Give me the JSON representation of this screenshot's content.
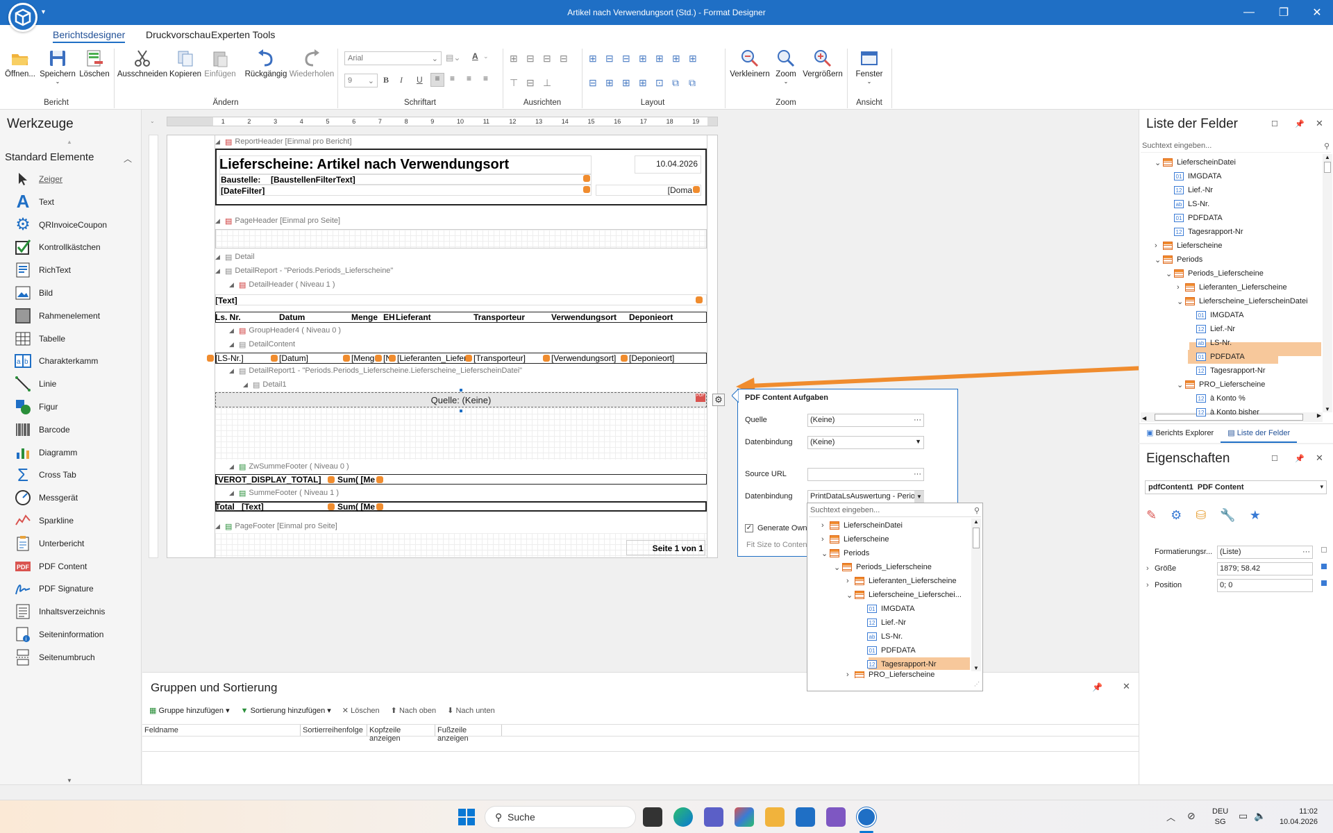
{
  "window": {
    "title": "Artikel nach Verwendungsort (Std.) - Format Designer"
  },
  "ribbon": {
    "tabs": [
      "Berichtsdesigner",
      "Druckvorschau",
      "Experten Tools"
    ],
    "buttons": {
      "open": "Öffnen...",
      "save": "Speichern",
      "delete": "Löschen",
      "cut": "Ausschneiden",
      "copy": "Kopieren",
      "paste": "Einfügen",
      "undo": "Rückgängig",
      "redo": "Wiederholen",
      "zoom_out": "Verkleinern",
      "zoom": "Zoom",
      "zoom_in": "Vergrößern",
      "window": "Fenster"
    },
    "font_name": "Arial",
    "font_size": "9",
    "groups": [
      "Bericht",
      "Ändern",
      "Schriftart",
      "Ausrichten",
      "Layout",
      "Zoom",
      "Ansicht"
    ]
  },
  "toolbox": {
    "title": "Werkzeuge",
    "section": "Standard Elemente",
    "items": [
      "Zeiger",
      "Text",
      "QRInvoiceCoupon",
      "Kontrollkästchen",
      "RichText",
      "Bild",
      "Rahmenelement",
      "Tabelle",
      "Charakterkamm",
      "Linie",
      "Figur",
      "Barcode",
      "Diagramm",
      "Cross Tab",
      "Messgerät",
      "Sparkline",
      "Unterbericht",
      "PDF Content",
      "PDF Signature",
      "Inhaltsverzeichnis",
      "Seiteninformation",
      "Seitenumbruch"
    ]
  },
  "ruler": [
    "1",
    "1",
    "2",
    "3",
    "4",
    "5",
    "6",
    "7",
    "8",
    "9",
    "10",
    "11",
    "12",
    "13",
    "14",
    "15",
    "16",
    "17",
    "18",
    "19"
  ],
  "report": {
    "bands": {
      "report_header": "ReportHeader [Einmal pro Bericht]",
      "page_header": "PageHeader [Einmal pro Seite]",
      "detail": "Detail",
      "detail_report": "DetailReport - \"Periods.Periods_Lieferscheine\"",
      "detail_header": "DetailHeader ( Niveau 1 )",
      "group_header": "GroupHeader4 ( Niveau 0 )",
      "detail_content": "DetailContent",
      "detail_report1": "DetailReport1 - \"Periods.Periods_Lieferscheine.Lieferscheine_LieferscheinDatei\"",
      "detail1": "Detail1",
      "zw_footer": "ZwSummeFooter ( Niveau 0 )",
      "summe_footer": "SummeFooter ( Niveau 1 )",
      "page_footer": "PageFooter [Einmal pro Seite]"
    },
    "title": "Lieferscheine: Artikel nach Verwendungsort",
    "date": "10.04.2026",
    "baustelle_label": "Baustelle:",
    "baustelle_value": "[BaustellenFilterText]",
    "date_filter": "[DateFilter]",
    "doma": "[Doma",
    "text_field": "[Text]",
    "columns": [
      "Ls. Nr.",
      "Datum",
      "Menge",
      "EH",
      "Lieferant",
      "Transporteur",
      "Verwendungsort",
      "Deponieort"
    ],
    "detail_fields": [
      "[LS-Nr.]",
      "[Datum]",
      "[Menge",
      "[N",
      "[Lieferanten_Liefer",
      "[Transporteur]",
      "[Verwendungsort]",
      "[Deponieort]"
    ],
    "pdf_source": "Quelle: (Keine)",
    "zw_display": "[VEROT_DISPLAY_TOTAL]",
    "sum1": "Sum( [Me",
    "total_label": "Total",
    "total_text": "[Text]",
    "sum2": "Sum( [Me",
    "page_info": "Seite 1 von 1"
  },
  "popup": {
    "title": "PDF Content Aufgaben",
    "source_label": "Quelle",
    "source_value": "(Keine)",
    "binding_label": "Datenbindung",
    "binding_value": "(Keine)",
    "url_label": "Source URL",
    "binding2_label": "Datenbindung",
    "binding2_value": "PrintDataLsAuswertung - Perio",
    "generate_label": "Generate Own",
    "fit_label": "Fit Size to Conten"
  },
  "dropdown": {
    "search_placeholder": "Suchtext eingeben...",
    "items": [
      "LieferscheinDatei",
      "Lieferscheine",
      "Periods",
      "Periods_Lieferscheine",
      "Lieferanten_Lieferscheine",
      "Lieferscheine_Lieferschei...",
      "IMGDATA",
      "Lief.-Nr",
      "LS-Nr.",
      "PDFDATA",
      "Tagesrapport-Nr",
      "PRO_Lieferscheine"
    ]
  },
  "field_list": {
    "title": "Liste der Felder",
    "search_placeholder": "Suchtext eingeben...",
    "items": [
      "LieferscheinDatei",
      "IMGDATA",
      "Lief.-Nr",
      "LS-Nr.",
      "PDFDATA",
      "Tagesrapport-Nr",
      "Lieferscheine",
      "Periods",
      "Periods_Lieferscheine",
      "Lieferanten_Lieferscheine",
      "Lieferscheine_LieferscheinDatei",
      "IMGDATA",
      "Lief.-Nr",
      "LS-Nr.",
      "PDFDATA",
      "Tagesrapport-Nr",
      "PRO_Lieferscheine",
      "à Konto %",
      "à Konto bisher"
    ],
    "tabs": [
      "Berichts Explorer",
      "Liste der Felder"
    ]
  },
  "properties": {
    "title": "Eigenschaften",
    "selected": "pdfContent1  PDF Content",
    "rows": [
      {
        "label": "Formatierungsr...",
        "value": "(Liste)"
      },
      {
        "label": "Größe",
        "value": "1879; 58.42"
      },
      {
        "label": "Position",
        "value": "0; 0"
      }
    ]
  },
  "groups_panel": {
    "title": "Gruppen und Sortierung",
    "toolbar": [
      "Gruppe hinzufügen",
      "Sortierung hinzufügen",
      "Löschen",
      "Nach oben",
      "Nach unten"
    ],
    "columns": [
      "Feldname",
      "Sortierreihenfolge",
      "Kopfzeile anzeigen",
      "Fußzeile anzeigen"
    ]
  },
  "taskbar": {
    "search": "Suche",
    "lang": "DEU",
    "region": "SG",
    "time": "11:02",
    "date": "10.04.2026"
  },
  "colors": {
    "accent": "#1f6fc5",
    "highlight": "#f7c89b",
    "arrow": "#f08c2e"
  }
}
